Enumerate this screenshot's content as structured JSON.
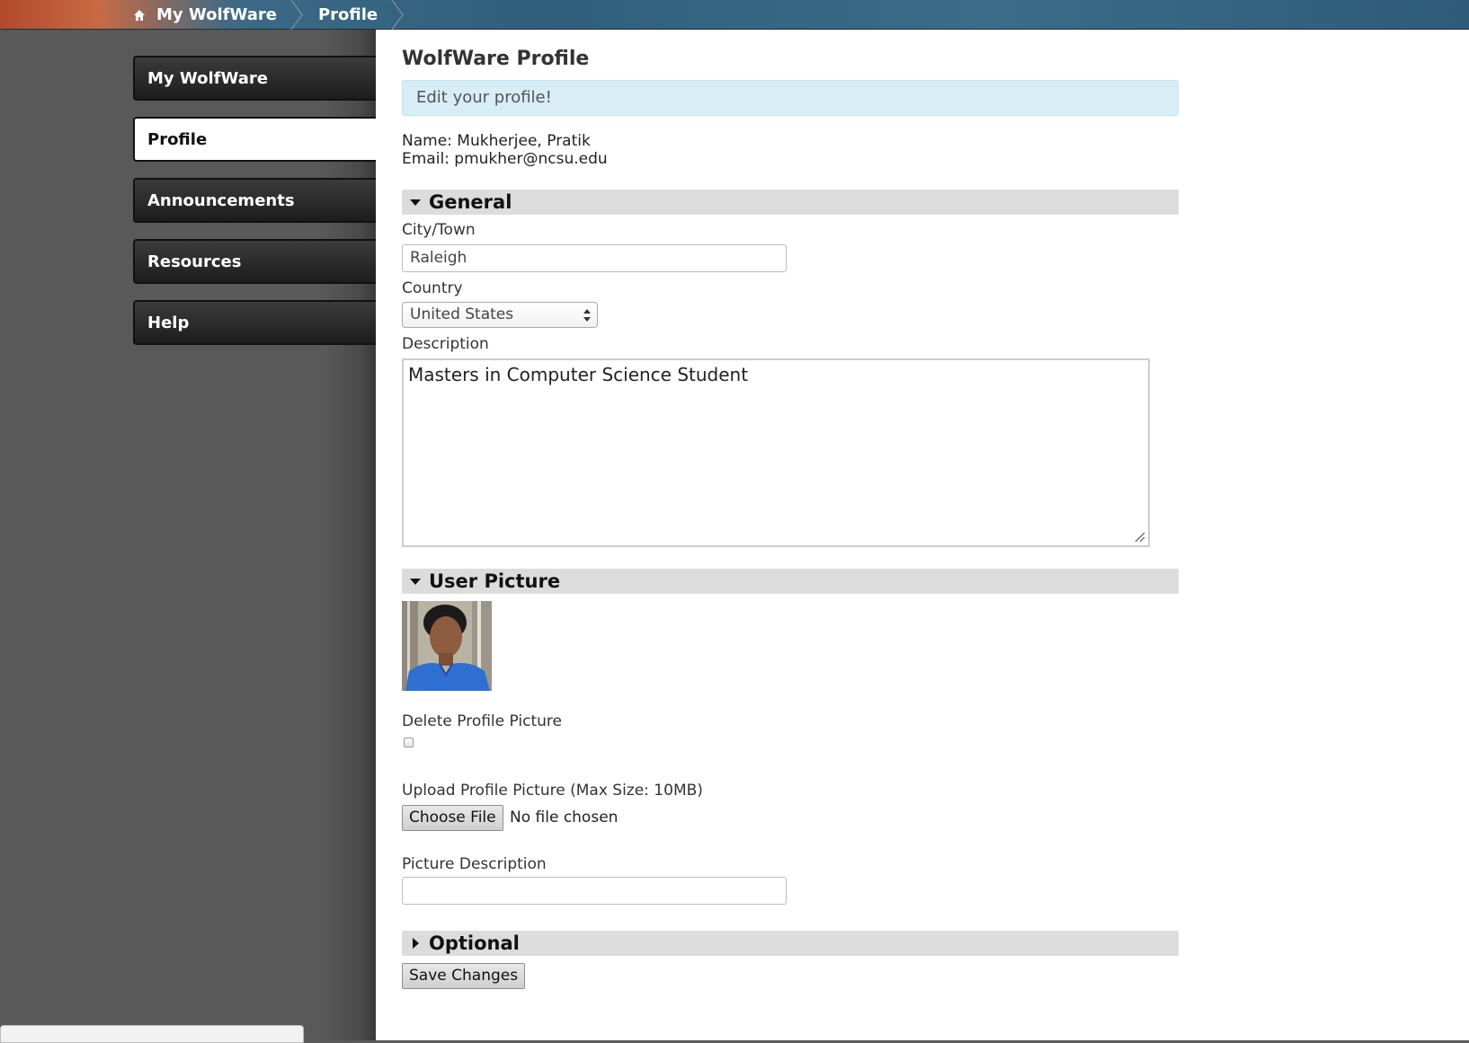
{
  "breadcrumb": {
    "home_icon": "home-icon",
    "items": [
      "My WolfWare",
      "Profile"
    ]
  },
  "nav": {
    "items": [
      {
        "label": "My WolfWare",
        "active": false
      },
      {
        "label": "Profile",
        "active": true
      },
      {
        "label": "Announcements",
        "active": false
      },
      {
        "label": "Resources",
        "active": false
      },
      {
        "label": "Help",
        "active": false
      }
    ]
  },
  "page": {
    "title": "WolfWare Profile",
    "info_message": "Edit your profile!",
    "name_line": "Name: Mukherjee, Pratik",
    "email_line": "Email: pmukher@ncsu.edu"
  },
  "general": {
    "header": "General",
    "city_label": "City/Town",
    "city_value": "Raleigh",
    "country_label": "Country",
    "country_value": "United States",
    "description_label": "Description",
    "description_value": "Masters in Computer Science Student"
  },
  "user_picture": {
    "header": "User Picture",
    "delete_label": "Delete Profile Picture",
    "delete_checked": false,
    "upload_label": "Upload Profile Picture (Max Size: 10MB)",
    "choose_file_label": "Choose File",
    "file_status": "No file chosen",
    "picture_description_label": "Picture Description",
    "picture_description_value": ""
  },
  "optional": {
    "header": "Optional"
  },
  "actions": {
    "save_label": "Save Changes"
  },
  "colors": {
    "info_bg": "#d9edf7",
    "section_bg": "#dcdcdc",
    "nav_dark": "#1d1d1d"
  }
}
